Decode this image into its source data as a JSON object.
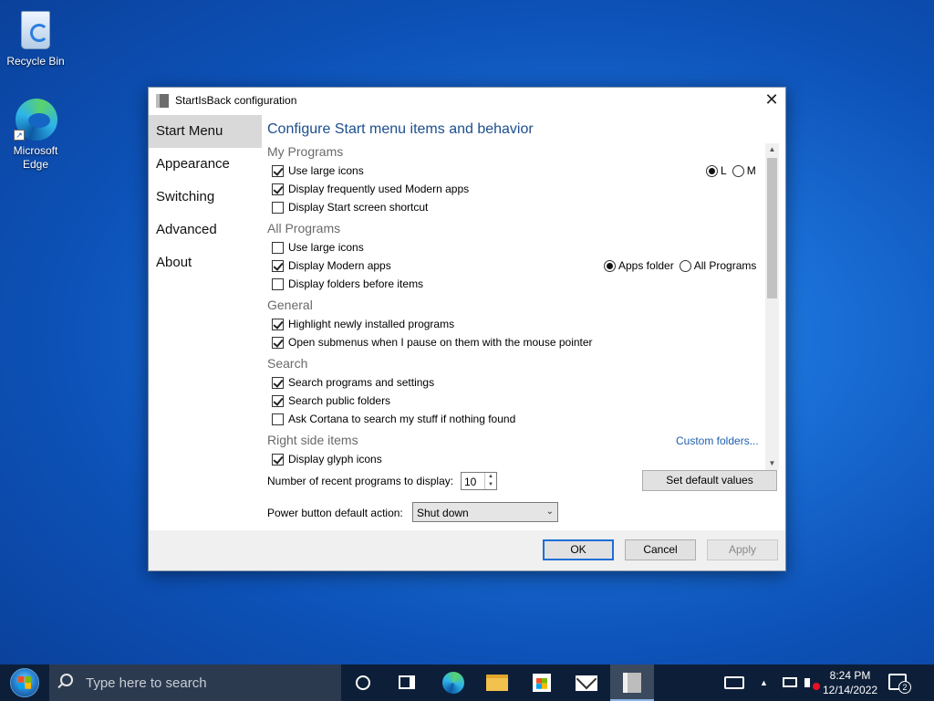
{
  "desktop": {
    "icons": [
      {
        "label": "Recycle Bin"
      },
      {
        "label": "Microsoft Edge"
      }
    ]
  },
  "dialog": {
    "title": "StartIsBack configuration",
    "nav": [
      "Start Menu",
      "Appearance",
      "Switching",
      "Advanced",
      "About"
    ],
    "active_nav": "Start Menu",
    "heading": "Configure Start menu items and behavior",
    "sections": {
      "my_programs": {
        "title": "My Programs",
        "options": [
          {
            "label": "Use large icons",
            "checked": true
          },
          {
            "label": "Display frequently used Modern apps",
            "checked": true
          },
          {
            "label": "Display Start screen shortcut",
            "checked": false
          }
        ],
        "size_options": [
          {
            "label": "L",
            "selected": true
          },
          {
            "label": "M",
            "selected": false
          }
        ]
      },
      "all_programs": {
        "title": "All Programs",
        "options": [
          {
            "label": "Use large icons",
            "checked": false
          },
          {
            "label": "Display Modern apps",
            "checked": true
          },
          {
            "label": "Display folders before items",
            "checked": false
          }
        ],
        "modern_apps_options": [
          {
            "label": "Apps folder",
            "selected": true
          },
          {
            "label": "All Programs",
            "selected": false
          }
        ]
      },
      "general": {
        "title": "General",
        "options": [
          {
            "label": "Highlight newly installed programs",
            "checked": true
          },
          {
            "label": "Open submenus when I pause on them with the mouse pointer",
            "checked": true
          }
        ]
      },
      "search": {
        "title": "Search",
        "options": [
          {
            "label": "Search programs and settings",
            "checked": true
          },
          {
            "label": "Search public folders",
            "checked": true
          },
          {
            "label": "Ask Cortana to search my stuff if nothing found",
            "checked": false
          }
        ]
      },
      "right_side": {
        "title": "Right side items",
        "link": "Custom folders...",
        "options": [
          {
            "label": "Display glyph icons",
            "checked": true
          }
        ]
      }
    },
    "recent_programs_label": "Number of recent programs to display:",
    "recent_programs_value": "10",
    "set_default_label": "Set default values",
    "power_label": "Power button default action:",
    "power_value": "Shut down",
    "buttons": {
      "ok": "OK",
      "cancel": "Cancel",
      "apply": "Apply"
    }
  },
  "taskbar": {
    "search_placeholder": "Type here to search",
    "time": "8:24 PM",
    "date": "12/14/2022",
    "notification_count": "2"
  }
}
